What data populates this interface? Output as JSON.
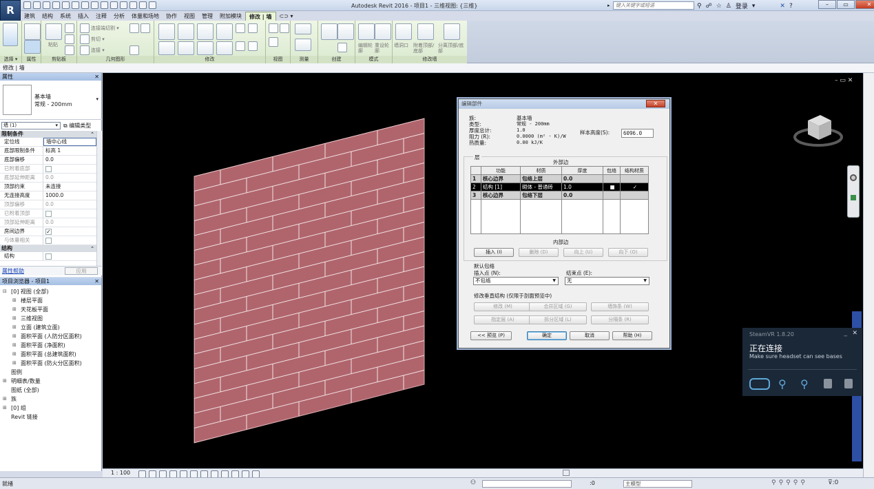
{
  "window": {
    "title": "Autodesk Revit 2016 -    项目1 - 三维视图: {三维}",
    "search_placeholder": "键入关键字或短语",
    "login_label": "登录",
    "app_button": "R"
  },
  "tabs": [
    "建筑",
    "结构",
    "系统",
    "插入",
    "注释",
    "分析",
    "体量和场地",
    "协作",
    "视图",
    "管理",
    "附加模块",
    "修改 | 墙"
  ],
  "ribbon": {
    "select_panel": {
      "label": "选择 ▾",
      "big_button": "修改"
    },
    "properties_panel": {
      "label": "属性"
    },
    "clipboard_panel": {
      "label": "剪贴板",
      "paste": "粘贴"
    },
    "geometry_panel": {
      "label": "几何图形",
      "items": [
        "连接端切割 ▾",
        "剪切 ▾",
        "连接 ▾"
      ]
    },
    "modify_panel": {
      "label": "修改"
    },
    "view_panel": {
      "label": "视图"
    },
    "measure_panel": {
      "label": "测量"
    },
    "create_panel": {
      "label": "创建"
    },
    "mode_panel": {
      "label": "模式",
      "items": [
        "编辑轮廓",
        "重设轮廓"
      ]
    },
    "modify_wall_panel": {
      "label": "修改墙",
      "items": [
        "墙洞口",
        "附着顶部/底部",
        "分离顶部/底部"
      ]
    }
  },
  "modebar": {
    "text": "修改 | 墙"
  },
  "properties": {
    "title": "属性",
    "type_family": "基本墙",
    "type_name": "常规 - 200mm",
    "instance_filter": "墙 (1)",
    "edit_type": "编辑类型",
    "groups": [
      {
        "name": "限制条件",
        "rows": [
          {
            "k": "定位线",
            "v": "墙中心线",
            "focus": true
          },
          {
            "k": "底部限制条件",
            "v": "标高 1"
          },
          {
            "k": "底部偏移",
            "v": "0.0"
          },
          {
            "k": "已附着底部",
            "v": "",
            "cb": true,
            "dis": true
          },
          {
            "k": "底部延伸距离",
            "v": "0.0",
            "dis": true
          },
          {
            "k": "顶部约束",
            "v": "未连接"
          },
          {
            "k": "无连接高度",
            "v": "1000.0"
          },
          {
            "k": "顶部偏移",
            "v": "0.0",
            "dis": true
          },
          {
            "k": "已附着顶部",
            "v": "",
            "cb": true,
            "dis": true
          },
          {
            "k": "顶部延伸距离",
            "v": "0.0",
            "dis": true
          },
          {
            "k": "房间边界",
            "v": "✓",
            "cb": true
          },
          {
            "k": "与体量相关",
            "v": "",
            "cb": true,
            "dis": true
          }
        ]
      },
      {
        "name": "结构",
        "rows": [
          {
            "k": "结构",
            "v": "",
            "cb": true
          }
        ]
      }
    ],
    "help_link": "属性帮助",
    "apply": "应用"
  },
  "browser": {
    "title": "项目浏览器 - 项目1",
    "items": [
      {
        "lvl": 0,
        "ex": "⊟",
        "txt": "[0] 视图 (全部)"
      },
      {
        "lvl": 1,
        "ex": "⊞",
        "txt": "楼层平面"
      },
      {
        "lvl": 1,
        "ex": "⊞",
        "txt": "天花板平面"
      },
      {
        "lvl": 1,
        "ex": "⊞",
        "txt": "三维视图"
      },
      {
        "lvl": 1,
        "ex": "⊞",
        "txt": "立面 (建筑立面)"
      },
      {
        "lvl": 1,
        "ex": "⊞",
        "txt": "面积平面 (人防分区面积)"
      },
      {
        "lvl": 1,
        "ex": "⊞",
        "txt": "面积平面 (净面积)"
      },
      {
        "lvl": 1,
        "ex": "⊞",
        "txt": "面积平面 (总建筑面积)"
      },
      {
        "lvl": 1,
        "ex": "⊞",
        "txt": "面积平面 (防火分区面积)"
      },
      {
        "lvl": 0,
        "ex": "",
        "txt": "图例"
      },
      {
        "lvl": 0,
        "ex": "⊞",
        "txt": "明细表/数量"
      },
      {
        "lvl": 0,
        "ex": "",
        "txt": "图纸 (全部)"
      },
      {
        "lvl": 0,
        "ex": "⊞",
        "txt": "族"
      },
      {
        "lvl": 0,
        "ex": "⊞",
        "txt": "[0] 组"
      },
      {
        "lvl": 0,
        "ex": "",
        "txt": "Revit 链接"
      }
    ]
  },
  "dialog": {
    "title": "编辑部件",
    "close": "✕",
    "family_k": "族:",
    "family_v": "基本墙",
    "type_k": "类型:",
    "type_v": "常规 - 200mm",
    "thick_k": "厚度总计:",
    "thick_v": "1.0",
    "res_k": "阻力 (R):",
    "res_v": "0.0000 (m² · K)/W",
    "mass_k": "热质量:",
    "mass_v": "0.00 kJ/K",
    "sample_k": "样本高度(S):",
    "sample_v": "6096.0",
    "layers_label": "层",
    "exterior": "外部边",
    "interior": "内部边",
    "columns": [
      "功能",
      "材质",
      "厚度",
      "包络",
      "结构材质"
    ],
    "rows": [
      {
        "n": "1",
        "f": "核心边界",
        "m": "包络上层",
        "t": "0.0",
        "wrap": "",
        "str": "",
        "type": "core"
      },
      {
        "n": "2",
        "f": "结构 [1]",
        "m": "砌体 - 普通砖",
        "t": "1.0",
        "wrap": "■",
        "str": "✓",
        "type": "sel"
      },
      {
        "n": "3",
        "f": "核心边界",
        "m": "包络下层",
        "t": "0.0",
        "wrap": "",
        "str": "",
        "type": "core"
      }
    ],
    "layer_buttons": [
      "插入 (I)",
      "删除 (D)",
      "向上 (U)",
      "向下 (O)"
    ],
    "wrap_label": "默认包络",
    "insert_pt_label": "插入点 (N):",
    "insert_pt_value": "不包络",
    "end_pt_label": "结束点 (E):",
    "end_pt_value": "无",
    "vert_label": "修改垂直结构 (仅限于剖面预览中)",
    "vert_buttons": [
      "修改 (M)",
      "合并区域 (G)",
      "墙饰条 (W)",
      "指定层 (A)",
      "拆分区域 (L)",
      "分隔条 (R)"
    ],
    "preview_btn": "<< 预览 (P)",
    "ok": "确定",
    "cancel": "取消",
    "help": "帮助 (H)"
  },
  "steamvr": {
    "title": "SteamVR 1.8.20",
    "heading": "正在连接",
    "sub": "Make sure headset can see bases"
  },
  "viewctrl": {
    "scale": "1 : 100"
  },
  "status": {
    "text": "就绪",
    "zero": ":0",
    "model": "主模型"
  },
  "colors": {
    "brick": "#b0656c",
    "mortar": "#f3e3e5",
    "ribbon": "#e5f0da",
    "accent": "#3f6fb5"
  }
}
